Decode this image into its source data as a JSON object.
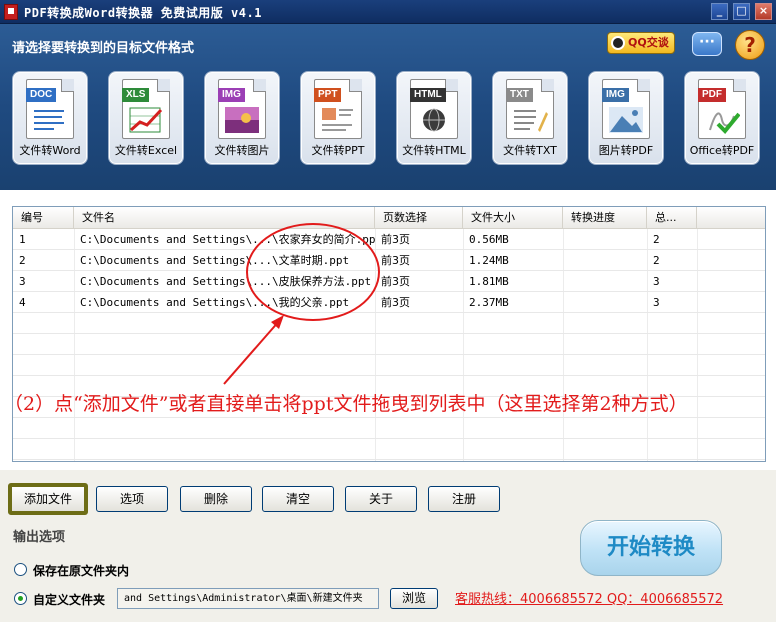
{
  "window": {
    "title": "PDF转换成Word转换器 免费试用版 v4.1",
    "min": "_",
    "max": "□",
    "close": "×"
  },
  "header": {
    "label": "请选择要转换到的目标文件格式",
    "qq": "QQ交谈",
    "chat": "···",
    "help": "?"
  },
  "formats": [
    {
      "tag": "DOC",
      "label": "文件转Word",
      "color": "#2f6fc4"
    },
    {
      "tag": "XLS",
      "label": "文件转Excel",
      "color": "#2e8b3a"
    },
    {
      "tag": "IMG",
      "label": "文件转图片",
      "color": "#9b3fb5"
    },
    {
      "tag": "PPT",
      "label": "文件转PPT",
      "color": "#d0501e"
    },
    {
      "tag": "HTML",
      "label": "文件转HTML",
      "color": "#333333"
    },
    {
      "tag": "TXT",
      "label": "文件转TXT",
      "color": "#8a8a8a"
    },
    {
      "tag": "IMG",
      "label": "图片转PDF",
      "color": "#3a6fa8"
    },
    {
      "tag": "PDF",
      "label": "Office转PDF",
      "color": "#c42d2d"
    }
  ],
  "table": {
    "headers": [
      "编号",
      "文件名",
      "页数选择",
      "文件大小",
      "转换进度",
      "总..."
    ],
    "rows": [
      [
        "1",
        "C:\\Documents and Settings\\...\\农家弃女的简介.ppt",
        "前3页",
        "0.56MB",
        "",
        "2"
      ],
      [
        "2",
        "C:\\Documents and Settings\\...\\文革时期.ppt",
        "前3页",
        "1.24MB",
        "",
        "2"
      ],
      [
        "3",
        "C:\\Documents and Settings\\...\\皮肤保养方法.ppt",
        "前3页",
        "1.81MB",
        "",
        "3"
      ],
      [
        "4",
        "C:\\Documents and Settings\\...\\我的父亲.ppt",
        "前3页",
        "2.37MB",
        "",
        "3"
      ]
    ]
  },
  "annotation": "（2）点“添加文件”或者直接单击将ppt文件拖曳到列表中（这里选择第2种方式）",
  "buttons": {
    "add": "添加文件",
    "options": "选项",
    "delete": "删除",
    "clear": "清空",
    "about": "关于",
    "register": "注册"
  },
  "output": {
    "group_label": "输出选项",
    "keep_original": "保存在原文件夹内",
    "custom_folder": "自定义文件夹",
    "path": "and Settings\\Administrator\\桌面\\新建文件夹",
    "browse": "浏览",
    "selected": "custom"
  },
  "hotline": "客服热线：4006685572 QQ：4006685572",
  "start": "开始转换"
}
